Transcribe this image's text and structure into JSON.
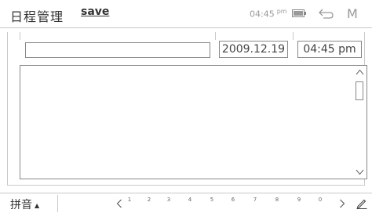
{
  "app": {
    "title": "日程管理"
  },
  "header": {
    "save_label": "save",
    "clock_time": "04:45",
    "clock_ampm": "pm",
    "menu_letter": "M"
  },
  "form": {
    "title_value": "",
    "date": "2009.12.19",
    "time": "04:45 pm",
    "body_value": ""
  },
  "ime": {
    "label": "拼音",
    "candidates": [
      "1",
      "2",
      "3",
      "4",
      "5",
      "6",
      "7",
      "8",
      "9",
      "0"
    ]
  },
  "icons": {
    "battery": "battery-icon",
    "back": "back-arrow-icon",
    "scroll_up": "chevron-up-icon",
    "scroll_down": "chevron-down-icon",
    "prev": "chevron-left-icon",
    "next": "chevron-right-icon",
    "edit": "pen-icon"
  },
  "colors": {
    "border": "#c9c9c9",
    "field_border": "#888888",
    "muted": "#999999",
    "text": "#333333"
  }
}
